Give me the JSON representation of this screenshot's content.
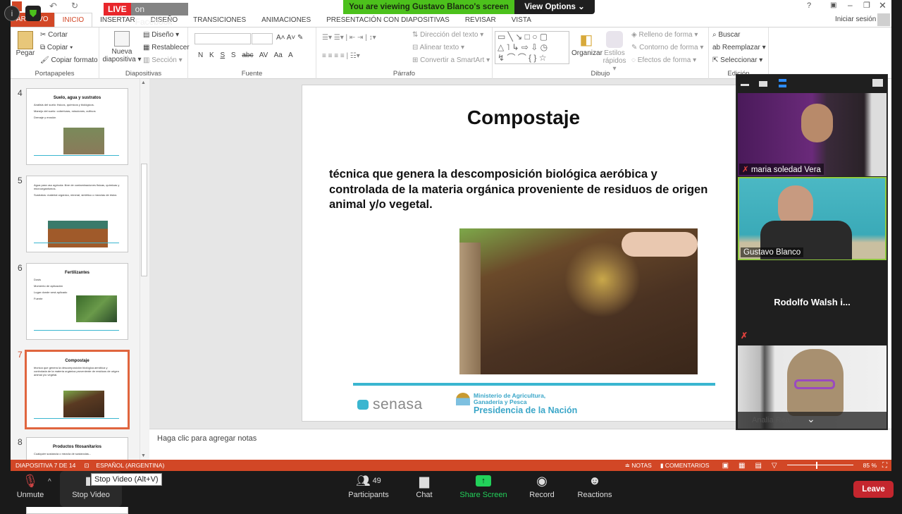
{
  "zoom_banner": {
    "viewing": "You are viewing Gustavo Blanco's screen",
    "view_options": "View Options"
  },
  "live": {
    "live": "LIVE",
    "platform": "on Facebook"
  },
  "window": {
    "help": "?",
    "signin": "Iniciar sesión"
  },
  "tabs": [
    "ARCHIVO",
    "INICIO",
    "INSERTAR",
    "DISEÑO",
    "TRANSICIONES",
    "ANIMACIONES",
    "PRESENTACIÓN CON DIAPOSITIVAS",
    "REVISAR",
    "VISTA"
  ],
  "ribbon": {
    "portapapeles": {
      "label": "Portapapeles",
      "pegar": "Pegar",
      "cortar": "Cortar",
      "copiar": "Copiar",
      "copiar_formato": "Copiar formato"
    },
    "diapositivas": {
      "label": "Diapositivas",
      "nueva": "Nueva",
      "diapositiva": "diapositiva",
      "diseno": "Diseño",
      "restablecer": "Restablecer",
      "seccion": "Sección"
    },
    "fuente": {
      "label": "Fuente",
      "buttons": [
        "N",
        "K",
        "S",
        "S",
        "abc",
        "AV",
        "Aa",
        "A"
      ]
    },
    "parrafo": {
      "label": "Párrafo",
      "direccion": "Dirección del texto",
      "alinear": "Alinear texto",
      "smartart": "Convertir a SmartArt"
    },
    "dibujo": {
      "label": "Dibujo",
      "organizar": "Organizar",
      "estilos": "Estilos",
      "rapidos": "rápidos",
      "relleno": "Relleno de forma",
      "contorno": "Contorno de forma",
      "efectos": "Efectos de forma"
    },
    "edicion": {
      "label": "Edición",
      "buscar": "Buscar",
      "reemplazar": "Reemplazar",
      "seleccionar": "Seleccionar"
    }
  },
  "thumbnails": [
    {
      "num": "4",
      "title": "Suelo, agua y sustratos",
      "lines": [
        "Análisis del suelo: físicos, químicos y biológicos.",
        "Manejo del suelo: coberturas, rotaciones, cultivos",
        "Drenaje y erosión"
      ]
    },
    {
      "num": "5",
      "title": "",
      "lines": [
        "Agua para uso agrícola: libre de contaminaciones fisicas, químicas y microorganismos.",
        "Sustratos: material orgánico, mineral, sintético o mezclas de éstos"
      ]
    },
    {
      "num": "6",
      "title": "Fertilizantes",
      "lines": [
        "Dosis",
        "Momento de aplicación",
        "Lugar donde será aplicado",
        "Fuente"
      ]
    },
    {
      "num": "7",
      "title": "Compostaje",
      "lines": [
        "técnica que genera la descomposición biológica aeróbica y controlada de la materia orgánica proveniente de residuos de origen animal y/o vegetal."
      ]
    },
    {
      "num": "8",
      "title": "Productos fitosanitarios",
      "lines": [
        "Cualquier sustancia o mezcla de sustancias..."
      ]
    }
  ],
  "slide": {
    "title": "Compostaje",
    "body": "técnica que genera la descomposición biológica aeróbica y controlada de la materia orgánica proveniente de residuos de origen animal y/o vegetal.",
    "logo1": "senasa",
    "ministry1": "Ministerio de Agricultura,",
    "ministry2": "Ganadería y Pesca",
    "presidencia": "Presidencia de la Nación"
  },
  "notes_placeholder": "Haga clic para agregar notas",
  "status": {
    "slide": "DIAPOSITIVA 7 DE 14",
    "lang": "ESPAÑOL (ARGENTINA)",
    "notas": "NOTAS",
    "comentarios": "COMENTARIOS",
    "zoom": "85 %",
    "zoom_level": 85
  },
  "participants": [
    {
      "name": "maria soledad Vera",
      "muted": true
    },
    {
      "name": "Gustavo Blanco",
      "muted": false,
      "active": true
    },
    {
      "name": "Rodolfo  Walsh  i...",
      "muted": true
    },
    {
      "name": "Analia Real",
      "muted": true
    }
  ],
  "toolbar": {
    "unmute": "Unmute",
    "stop_video": "Stop Video",
    "tooltip": "Stop Video (Alt+V)",
    "participants": "Participants",
    "participant_count": "49",
    "chat": "Chat",
    "share": "Share Screen",
    "record": "Record",
    "reactions": "Reactions",
    "leave": "Leave"
  },
  "colors": {
    "ppt_accent": "#d24726",
    "zoom_green": "#4cc11c",
    "share_green": "#22d15a",
    "leave": "#c4262e",
    "speaker_border": "#8fc940"
  }
}
